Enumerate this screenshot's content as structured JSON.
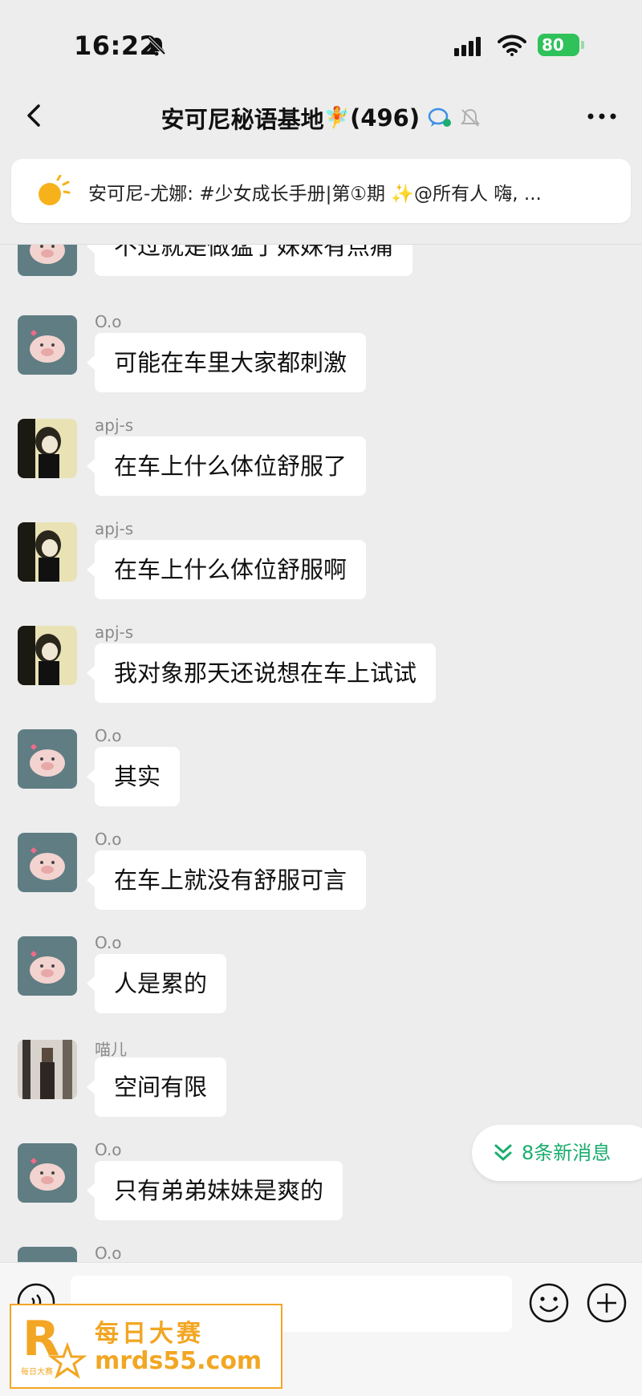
{
  "status_bar": {
    "time": "16:22",
    "battery": "80"
  },
  "header": {
    "title": "安可尼秘语基地",
    "title_emoji": "🧚",
    "member_count": "(496)"
  },
  "pinned": {
    "text": "安可尼-尤娜: #少女成长手册|第①期 ✨@所有人  嗨, ..."
  },
  "messages": [
    {
      "sender": "",
      "text": "不过就是做猛了妹妹有点痛"
    },
    {
      "sender": "O.o",
      "text": "可能在车里大家都刺激"
    },
    {
      "sender": "apj-s",
      "text": "在车上什么体位舒服了"
    },
    {
      "sender": "apj-s",
      "text": "在车上什么体位舒服啊"
    },
    {
      "sender": "apj-s",
      "text": "我对象那天还说想在车上试试"
    },
    {
      "sender": "O.o",
      "text": "其实"
    },
    {
      "sender": "O.o",
      "text": "在车上就没有舒服可言"
    },
    {
      "sender": "O.o",
      "text": "人是累的"
    },
    {
      "sender": "喵儿",
      "text": "空间有限"
    },
    {
      "sender": "O.o",
      "text": "只有弟弟妹妹是爽的"
    },
    {
      "sender": "O.o",
      "text": ""
    }
  ],
  "new_messages": {
    "label": "8条新消息"
  },
  "watermark": {
    "line1": "每日大赛",
    "line2": "mrds55.com",
    "logo_text": "R 每日大赛"
  },
  "colors": {
    "accent_green": "#1aad6e",
    "battery_green": "#2fc15a",
    "watermark_orange": "#f2a623"
  }
}
